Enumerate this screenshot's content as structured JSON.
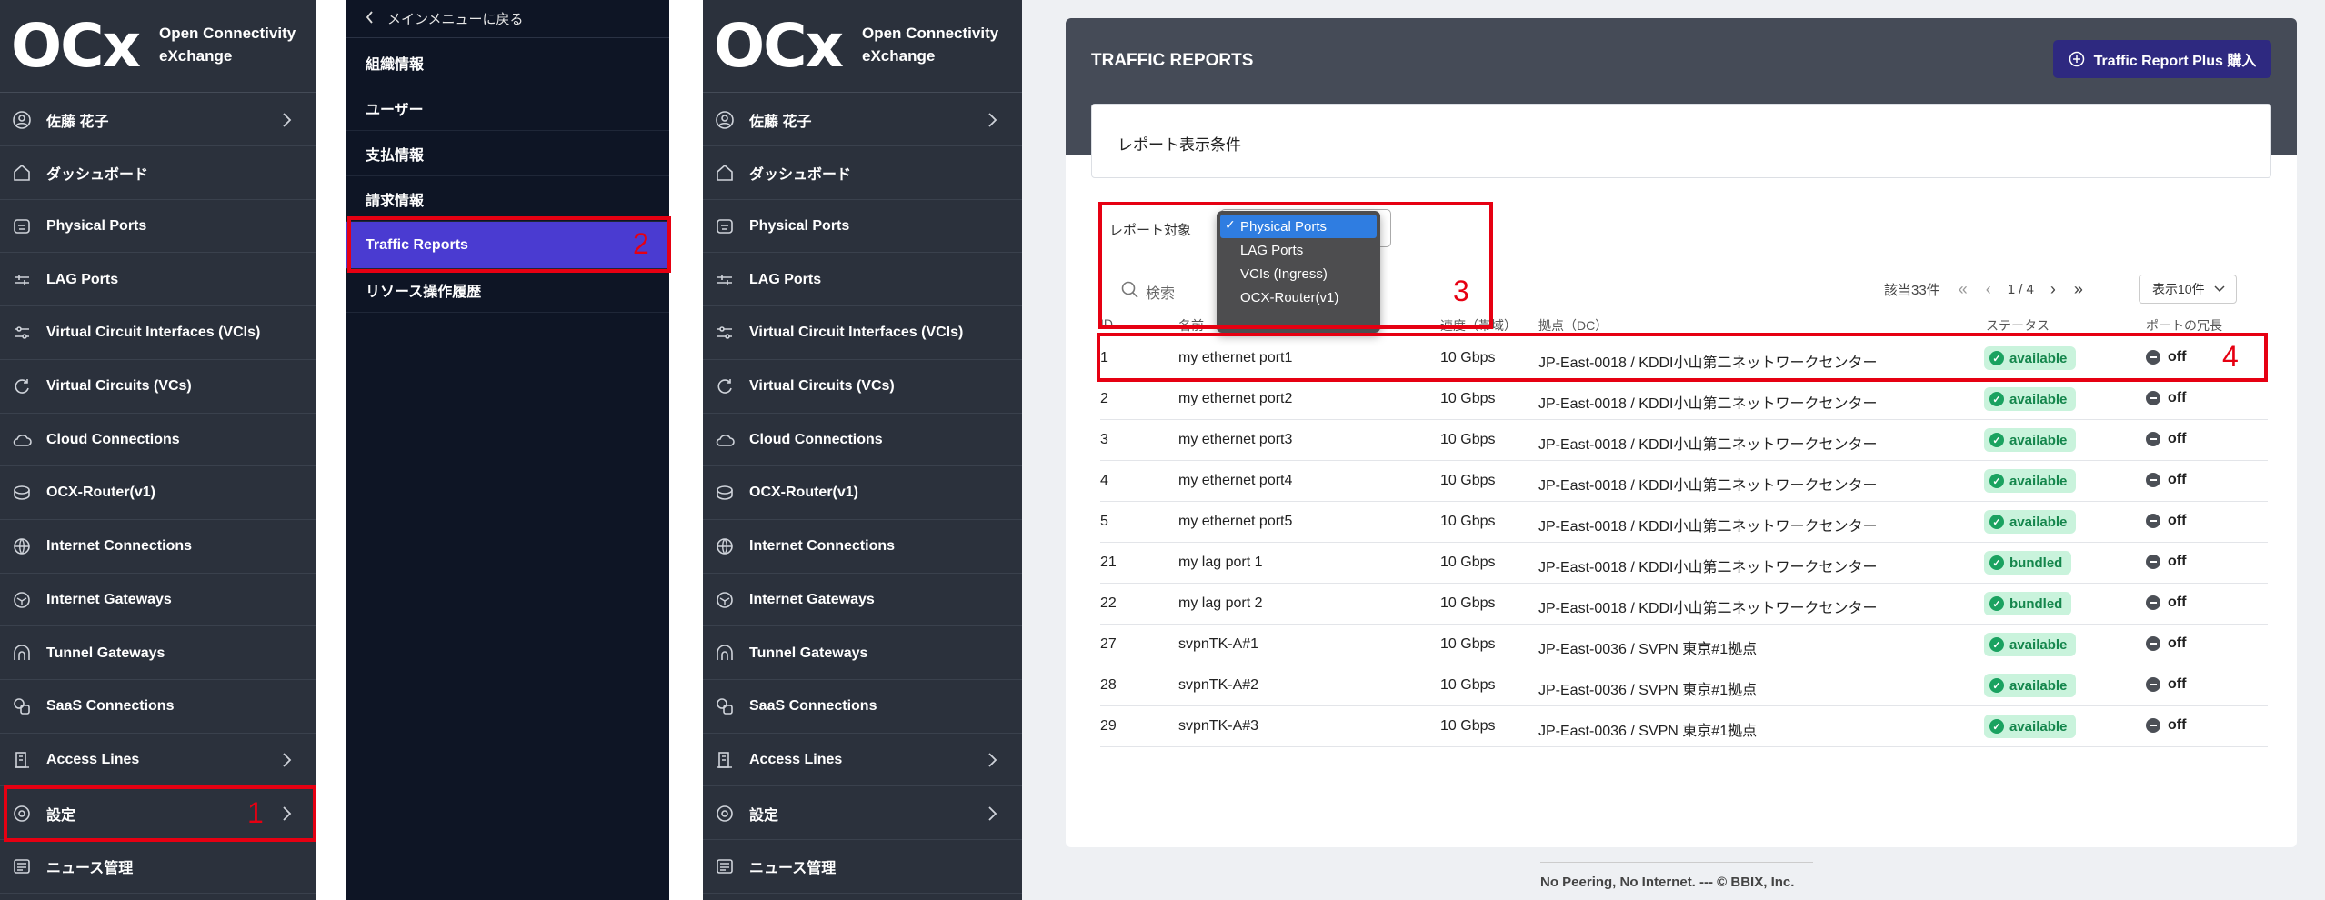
{
  "logo": {
    "mark": "OCx",
    "line1": "Open Connectivity",
    "line2": "eXchange"
  },
  "sidebar": {
    "items": [
      {
        "label": "佐藤 花子",
        "icon": "user-icon",
        "chevron": true
      },
      {
        "label": "ダッシュボード",
        "icon": "home-icon",
        "chevron": false
      },
      {
        "label": "Physical Ports",
        "icon": "port-icon",
        "chevron": false
      },
      {
        "label": "LAG Ports",
        "icon": "lag-icon",
        "chevron": false
      },
      {
        "label": "Virtual Circuit Interfaces (VCIs)",
        "icon": "sliders-icon",
        "chevron": false
      },
      {
        "label": "Virtual Circuits (VCs)",
        "icon": "refresh-icon",
        "chevron": false
      },
      {
        "label": "Cloud Connections",
        "icon": "cloud-icon",
        "chevron": false
      },
      {
        "label": "OCX-Router(v1)",
        "icon": "router-icon",
        "chevron": false
      },
      {
        "label": "Internet Connections",
        "icon": "globe-icon",
        "chevron": false
      },
      {
        "label": "Internet Gateways",
        "icon": "gateway-icon",
        "chevron": false
      },
      {
        "label": "Tunnel Gateways",
        "icon": "tunnel-icon",
        "chevron": false
      },
      {
        "label": "SaaS Connections",
        "icon": "saas-icon",
        "chevron": false
      },
      {
        "label": "Access Lines",
        "icon": "building-icon",
        "chevron": true
      },
      {
        "label": "設定",
        "icon": "settings-icon",
        "chevron": true
      },
      {
        "label": "ニュース管理",
        "icon": "news-icon",
        "chevron": false
      }
    ]
  },
  "submenu": {
    "back_label": "メインメニューに戻る",
    "items": [
      "組織情報",
      "ユーザー",
      "支払情報",
      "請求情報",
      "Traffic Reports",
      "リソース操作履歴"
    ]
  },
  "main": {
    "title": "TRAFFIC REPORTS",
    "plus_button": "Traffic Report Plus 購入",
    "conditions_title": "レポート表示条件",
    "filter_label": "レポート対象",
    "dropdown_options": [
      "Physical Ports",
      "LAG Ports",
      "VCIs (Ingress)",
      "OCX-Router(v1)"
    ],
    "selected_option": "Physical Ports",
    "search_placeholder": "検索",
    "count_text": "該当33件",
    "page_text": "1 / 4",
    "page_size": "表示10件",
    "columns": [
      "ID",
      "名前",
      "速度（帯域）",
      "拠点（DC）",
      "ステータス",
      "ポートの冗長"
    ],
    "rows": [
      {
        "id": "1",
        "name": "my ethernet port1",
        "speed": "10 Gbps",
        "dc": "JP-East-0018 / KDDI小山第二ネットワークセンター",
        "status": "available",
        "redundancy": "off"
      },
      {
        "id": "2",
        "name": "my ethernet port2",
        "speed": "10 Gbps",
        "dc": "JP-East-0018 / KDDI小山第二ネットワークセンター",
        "status": "available",
        "redundancy": "off"
      },
      {
        "id": "3",
        "name": "my ethernet port3",
        "speed": "10 Gbps",
        "dc": "JP-East-0018 / KDDI小山第二ネットワークセンター",
        "status": "available",
        "redundancy": "off"
      },
      {
        "id": "4",
        "name": "my ethernet port4",
        "speed": "10 Gbps",
        "dc": "JP-East-0018 / KDDI小山第二ネットワークセンター",
        "status": "available",
        "redundancy": "off"
      },
      {
        "id": "5",
        "name": "my ethernet port5",
        "speed": "10 Gbps",
        "dc": "JP-East-0018 / KDDI小山第二ネットワークセンター",
        "status": "available",
        "redundancy": "off"
      },
      {
        "id": "21",
        "name": "my lag port 1",
        "speed": "10 Gbps",
        "dc": "JP-East-0018 / KDDI小山第二ネットワークセンター",
        "status": "bundled",
        "redundancy": "off"
      },
      {
        "id": "22",
        "name": "my lag port 2",
        "speed": "10 Gbps",
        "dc": "JP-East-0018 / KDDI小山第二ネットワークセンター",
        "status": "bundled",
        "redundancy": "off"
      },
      {
        "id": "27",
        "name": "svpnTK-A#1",
        "speed": "10 Gbps",
        "dc": "JP-East-0036 / SVPN 東京#1拠点",
        "status": "available",
        "redundancy": "off"
      },
      {
        "id": "28",
        "name": "svpnTK-A#2",
        "speed": "10 Gbps",
        "dc": "JP-East-0036 / SVPN 東京#1拠点",
        "status": "available",
        "redundancy": "off"
      },
      {
        "id": "29",
        "name": "svpnTK-A#3",
        "speed": "10 Gbps",
        "dc": "JP-East-0036 / SVPN 東京#1拠点",
        "status": "available",
        "redundancy": "off"
      }
    ],
    "footer": "No Peering, No Internet. --- © BBIX, Inc."
  },
  "annotations": [
    "1",
    "2",
    "3",
    "4"
  ],
  "colors": {
    "sidebar_bg": "#2b313c",
    "submenu_bg": "#0e1525",
    "active_item": "#4a3bd1",
    "annotation_red": "#e60012",
    "status_green": "#1aa260"
  }
}
